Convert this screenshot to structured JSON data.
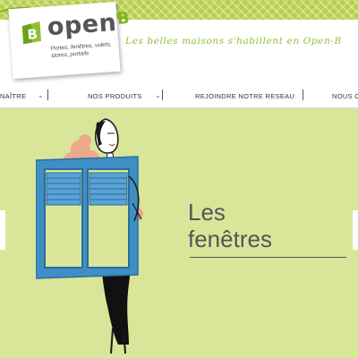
{
  "header": {
    "logo": {
      "name": "open",
      "suffix": "B",
      "subtitle": "Portes, fenêtres, volets, stores, portails"
    },
    "tagline": "Les belles maisons s'habillent en Open-B"
  },
  "nav": {
    "items": [
      {
        "label": "NAÎTRE"
      },
      {
        "label": "NOS PRODUITS"
      },
      {
        "label": "REJOINDRE NOTRE RESEAU"
      },
      {
        "label": "NOUS CO"
      }
    ]
  },
  "hero": {
    "title_line1": "Les",
    "title_line2": "fenêtres"
  },
  "colors": {
    "accent": "#7fb21f",
    "hero_bg": "#d9e69a",
    "window_blue": "#3f8fc4"
  }
}
